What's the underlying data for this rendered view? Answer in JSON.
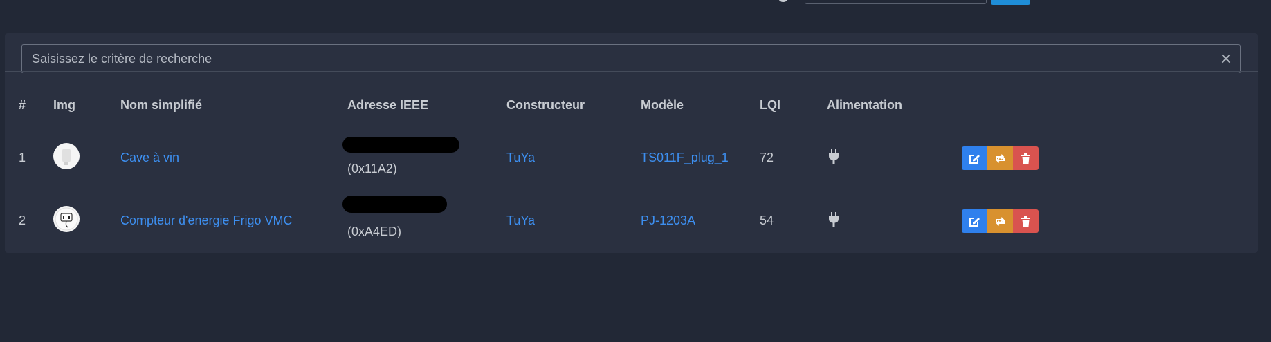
{
  "search": {
    "placeholder": "Saisissez le critère de recherche",
    "value": ""
  },
  "table": {
    "headers": [
      "#",
      "Img",
      "Nom simplifié",
      "Adresse IEEE",
      "Constructeur",
      "Modèle",
      "LQI",
      "Alimentation"
    ],
    "rows": [
      {
        "num": "1",
        "name": "Cave à vin",
        "ieee_short": "(0x11A2)",
        "manufacturer": "TuYa",
        "model": "TS011F_plug_1",
        "lqi": "72",
        "power_icon": "plug-icon"
      },
      {
        "num": "2",
        "name": "Compteur d'energie Frigo VMC",
        "ieee_short": "(0xA4ED)",
        "manufacturer": "TuYa",
        "model": "PJ-1203A",
        "lqi": "54",
        "power_icon": "plug-icon"
      }
    ]
  },
  "colors": {
    "edit": "#2f80ed",
    "sync": "#d8912f",
    "delete": "#d9534f",
    "link": "#3d8ff0",
    "background": "#222836",
    "card": "#2a3040"
  }
}
